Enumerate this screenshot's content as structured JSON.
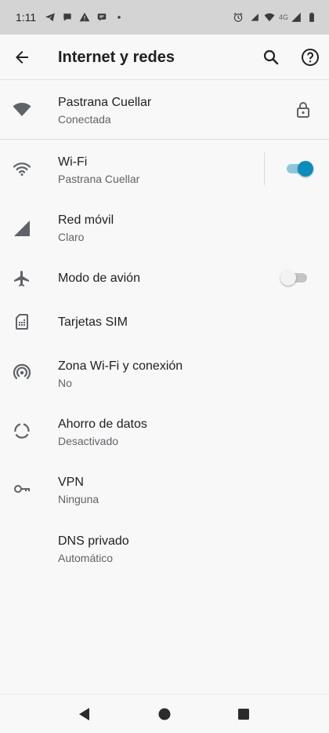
{
  "status_bar": {
    "time": "1:11",
    "network_label": "4G",
    "icons_left": [
      "telegram-icon",
      "chat-bubble-icon",
      "warning-icon",
      "message-icon",
      "dot-icon"
    ],
    "icons_right": [
      "alarm-icon",
      "signal-bars-icon",
      "wifi-icon",
      "cell-signal-icon",
      "battery-icon"
    ]
  },
  "app_bar": {
    "title": "Internet y redes",
    "icons": [
      "back-arrow-icon",
      "search-icon",
      "help-icon"
    ]
  },
  "connected_network": {
    "name": "Pastrana Cuellar",
    "status": "Conectada",
    "icons": [
      "wifi-filled-icon",
      "lock-icon"
    ]
  },
  "items": [
    {
      "id": "wifi",
      "label": "Wi-Fi",
      "sub": "Pastrana Cuellar",
      "icon": "wifi-icon",
      "toggle": true
    },
    {
      "id": "mobile",
      "label": "Red móvil",
      "sub": "Claro",
      "icon": "cell-signal-icon"
    },
    {
      "id": "airplane",
      "label": "Modo de avión",
      "sub": "",
      "icon": "airplane-icon",
      "toggle": false
    },
    {
      "id": "sim",
      "label": "Tarjetas SIM",
      "sub": "",
      "icon": "sim-card-icon"
    },
    {
      "id": "hotspot",
      "label": "Zona Wi-Fi y conexión",
      "sub": "No",
      "icon": "hotspot-icon"
    },
    {
      "id": "datasaver",
      "label": "Ahorro de datos",
      "sub": "Desactivado",
      "icon": "data-saver-icon"
    },
    {
      "id": "vpn",
      "label": "VPN",
      "sub": "Ninguna",
      "icon": "vpn-key-icon"
    },
    {
      "id": "dns",
      "label": "DNS privado",
      "sub": "Automático",
      "icon": ""
    }
  ],
  "colors": {
    "accent": "#0a8cbd",
    "accent_track": "#8fc6db",
    "text_primary": "#202124",
    "text_secondary": "#5f6368",
    "icon": "#5f6368",
    "status_bar_bg": "#d4d4d4",
    "background": "#f8f8f8"
  },
  "nav_bar": {
    "icons": [
      "back-triangle-icon",
      "home-circle-icon",
      "recents-square-icon"
    ]
  }
}
